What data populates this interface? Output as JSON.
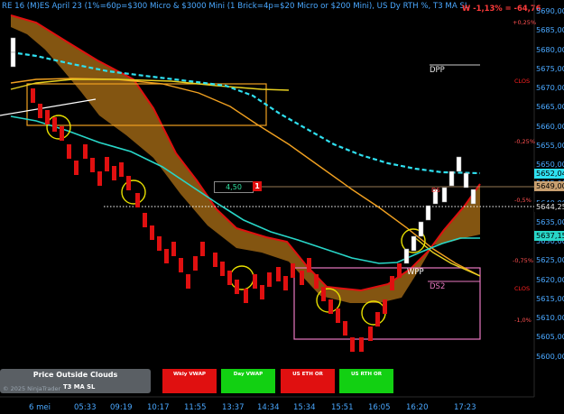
{
  "header": {
    "title": "RE 16 (M)ES April 23 (1%=60p=$300 Micro & $3000 Mini  (1 Brick=4p=$20 Micro or $200 Mini), US Dy RTH %, T3 MA SL",
    "pnl": "W -1,13% = -64,76"
  },
  "price_axis": {
    "ticks": [
      "5690,00",
      "5685,00",
      "5680,00",
      "5675,00",
      "5670,00",
      "5665,00",
      "5660,00",
      "5655,00",
      "5650,00",
      "5645,00",
      "5640,00",
      "5635,00",
      "5630,00",
      "5625,00",
      "5620,00",
      "5615,00",
      "5610,00",
      "5605,00",
      "5600,00"
    ],
    "tags": {
      "cyan_ma": "5652,04",
      "last": "5649,00",
      "dotted": "5644,25",
      "teal_ma": "5637,15"
    }
  },
  "time_axis": [
    "6 mei",
    "05:33",
    "09:19",
    "10:17",
    "11:55",
    "13:37",
    "14:34",
    "15:34",
    "15:51",
    "16:05",
    "16:20",
    "17:23"
  ],
  "markers": {
    "pct": [
      "+0,25%",
      "-0,25%",
      "-0,5%",
      "-0,75%",
      "-1,0%"
    ],
    "clos": "CLOS",
    "dpp": "DPP",
    "wpp": "WPP",
    "ds2": "DS2",
    "ds1": "DS"
  },
  "brick_box": {
    "value": "4,50",
    "count": "1"
  },
  "panel": {
    "title": "Price Outside Clouds",
    "subtitle": "T3 MA SL",
    "copyright": "© 2025 NinjaTrader"
  },
  "buttons": [
    {
      "label": "Wkly VWAP",
      "color": "red"
    },
    {
      "label": "Day VWAP",
      "color": "green"
    },
    {
      "label": "US ETH OR",
      "color": "red"
    },
    {
      "label": "US RTH OR",
      "color": "green"
    }
  ],
  "colors": {
    "background": "#000000",
    "up_brick": "#ffffff",
    "down_brick": "#e01010",
    "cloud": "#8a5a12",
    "cyan_ma": "#2fe0f0",
    "teal_ma": "#28d6c8",
    "orange_ma": "#f0a020",
    "yellow_ma": "#e8d020",
    "axis_text": "#4aa8ff"
  }
}
